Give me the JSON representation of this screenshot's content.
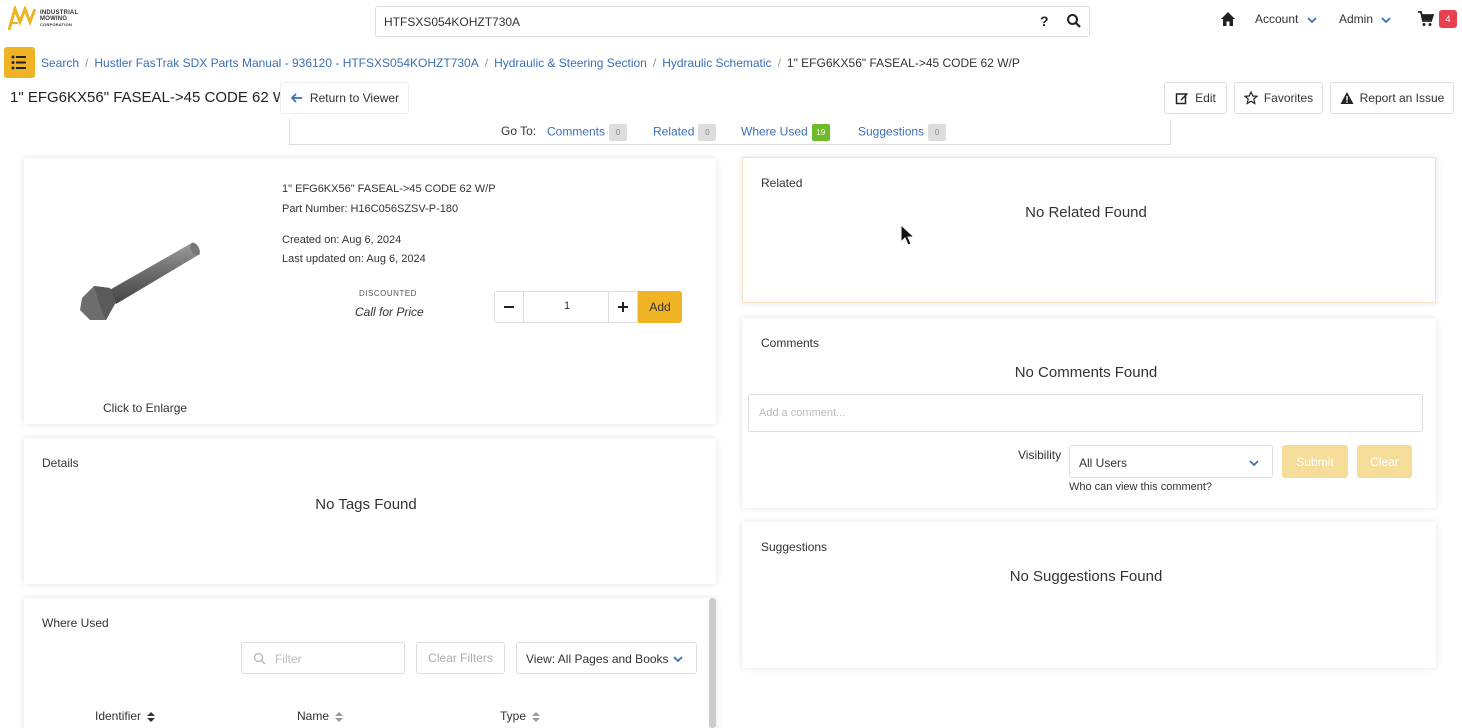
{
  "brand": {
    "logo_line1": "INDUSTRIAL",
    "logo_line2": "MOWING",
    "logo_line3": "CORPORATION",
    "accent_color": "#f0b323"
  },
  "header": {
    "search_value": "HTFSXS054KOHZT730A",
    "help_label": "?",
    "account_label": "Account",
    "admin_label": "Admin",
    "cart_count": "4"
  },
  "breadcrumb": {
    "items": [
      "Search",
      "Hustler FasTrak SDX Parts Manual - 936120 - HTFSXS054KOHZT730A",
      "Hydraulic & Steering Section",
      "Hydraulic Schematic"
    ],
    "current": "1\" EFG6KX56\" FASEAL->45 CODE 62 W/P"
  },
  "title_row": {
    "title": "1\" EFG6KX56\" FASEAL->45 CODE 62 W/P",
    "return_label": "Return to Viewer",
    "edit_label": "Edit",
    "favorites_label": "Favorites",
    "report_label": "Report an Issue"
  },
  "goto": {
    "label": "Go To:",
    "links": [
      {
        "label": "Comments",
        "count": "0"
      },
      {
        "label": "Related",
        "count": "0"
      },
      {
        "label": "Where Used",
        "count": "19"
      },
      {
        "label": "Suggestions",
        "count": "0"
      }
    ]
  },
  "part": {
    "name": "1\" EFG6KX56\" FASEAL->45 CODE 62 W/P",
    "part_number": "Part Number: H16C056SZSV-P-180",
    "created": "Created on: Aug 6, 2024",
    "updated": "Last updated on: Aug 6, 2024",
    "discounted_label": "DISCOUNTED",
    "price_label": "Call for Price",
    "quantity": "1",
    "add_label": "Add",
    "enlarge_label": "Click to Enlarge"
  },
  "details": {
    "title": "Details",
    "empty": "No Tags Found"
  },
  "where_used": {
    "title": "Where Used",
    "filter_placeholder": "Filter",
    "clear_filters_label": "Clear Filters",
    "view_label": "View: All Pages and Books",
    "columns": [
      "Identifier",
      "Name",
      "Type"
    ]
  },
  "related": {
    "title": "Related",
    "empty": "No Related Found"
  },
  "comments": {
    "title": "Comments",
    "empty": "No Comments Found",
    "placeholder": "Add a comment...",
    "visibility_label": "Visibility",
    "visibility_value": "All Users",
    "visibility_help": "Who can view this comment?",
    "submit_label": "Submit",
    "clear_label": "Clear"
  },
  "suggestions": {
    "title": "Suggestions",
    "empty": "No Suggestions Found"
  }
}
